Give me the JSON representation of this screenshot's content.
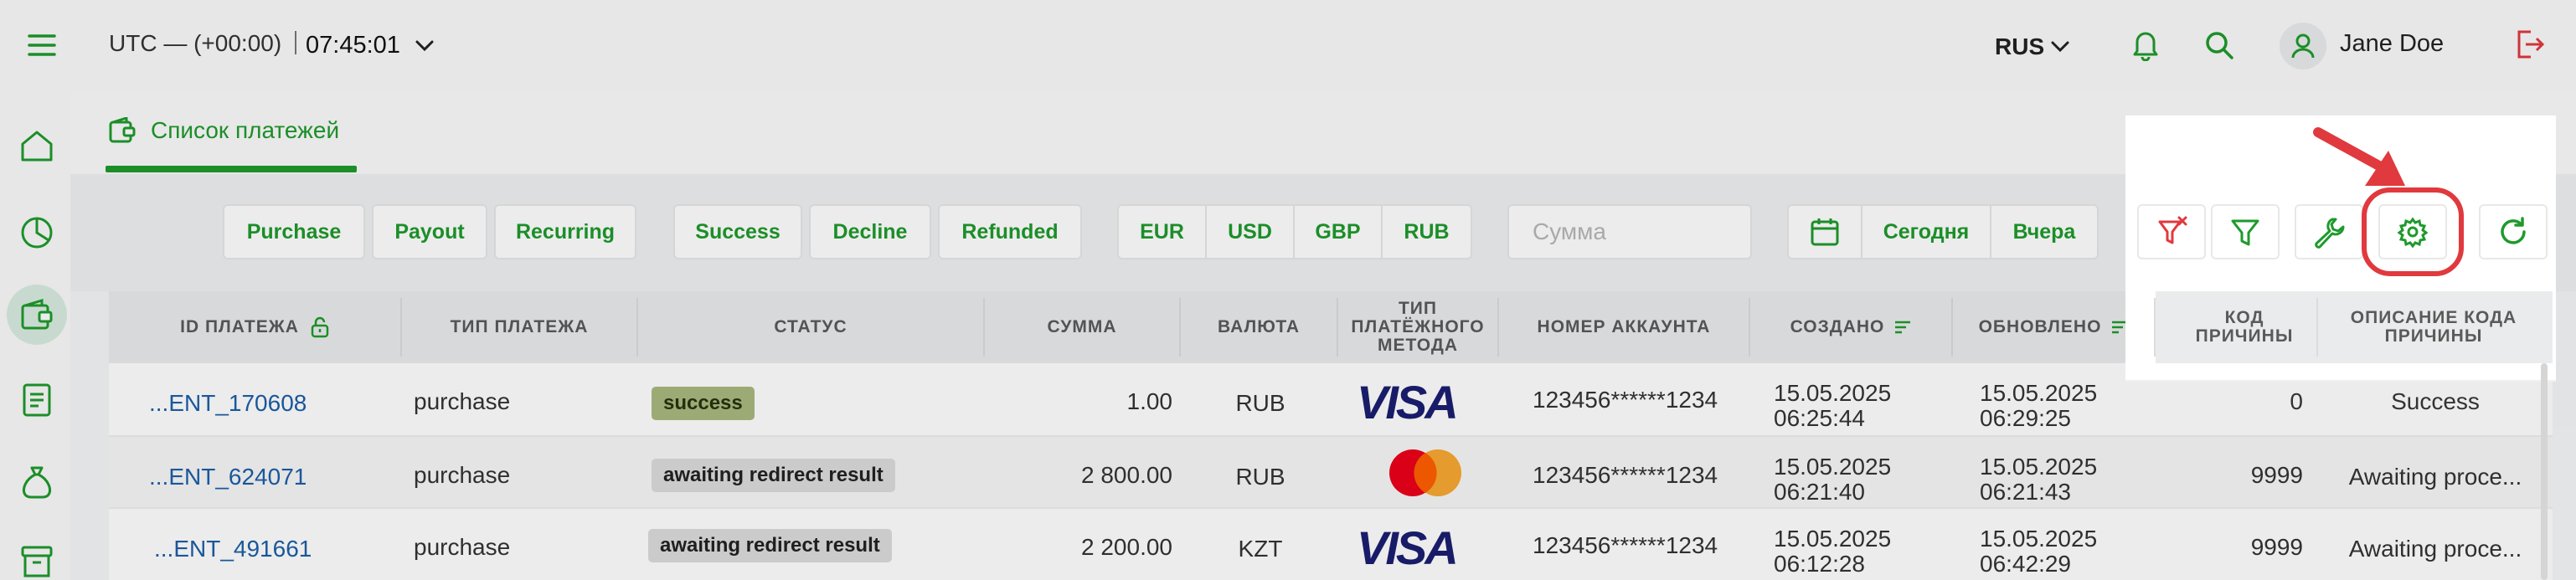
{
  "header": {
    "timezone_label": "UTC — (+00:00)",
    "time": "07:45:01",
    "language": "RUS",
    "user_name": "Jane Doe"
  },
  "tab": {
    "label": "Список платежей"
  },
  "filters": {
    "type_buttons": [
      "Purchase",
      "Payout",
      "Recurring"
    ],
    "status_buttons": [
      "Success",
      "Decline",
      "Refunded"
    ],
    "currency_buttons": [
      "EUR",
      "USD",
      "GBP",
      "RUB"
    ],
    "amount_placeholder": "Сумма",
    "date_buttons": [
      "Сегодня",
      "Вчера"
    ]
  },
  "table": {
    "headers": {
      "id": "ID ПЛАТЕЖА",
      "type": "ТИП ПЛАТЕЖА",
      "status": "СТАТУС",
      "amount": "СУММА",
      "currency": "ВАЛЮТА",
      "method": "ТИП ПЛАТЁЖНОГО МЕТОДА",
      "account": "НОМЕР АККАУНТА",
      "created": "СОЗДАНО",
      "updated": "ОБНОВЛЕНО",
      "reason_code": "КОД ПРИЧИНЫ",
      "reason_desc": "ОПИСАНИЕ КОДА ПРИЧИНЫ"
    },
    "rows": [
      {
        "id": "...ENT_170608",
        "type": "purchase",
        "status": "success",
        "amount": "1.00",
        "currency": "RUB",
        "method": "VISA",
        "account": "123456******1234",
        "created_date": "15.05.2025",
        "created_time": "06:25:44",
        "updated_date": "15.05.2025",
        "updated_time": "06:29:25",
        "reason_code": "0",
        "reason_desc": "Success"
      },
      {
        "id": "...ENT_624071",
        "type": "purchase",
        "status": "awaiting redirect result",
        "amount": "2 800.00",
        "currency": "RUB",
        "method": "mastercard",
        "account": "123456******1234",
        "created_date": "15.05.2025",
        "created_time": "06:21:40",
        "updated_date": "15.05.2025",
        "updated_time": "06:21:43",
        "reason_code": "9999",
        "reason_desc": "Awaiting proce..."
      },
      {
        "id": "...ENT_491661",
        "type": "purchase",
        "status": "awaiting redirect result",
        "amount": "2 200.00",
        "currency": "KZT",
        "method": "VISA",
        "account": "123456******1234",
        "created_date": "15.05.2025",
        "created_time": "06:12:28",
        "updated_date": "15.05.2025",
        "updated_time": "06:42:29",
        "reason_code": "9999",
        "reason_desc": "Awaiting proce..."
      }
    ]
  },
  "colors": {
    "accent": "#1e9a2c",
    "link": "#1d5fa8",
    "annotation": "#e0393e",
    "success_badge": "#a9b97f",
    "pending_badge": "#dcdcdc"
  },
  "icons": {
    "menu": "hamburger-icon",
    "sidebar": [
      "home-icon",
      "pie-chart-icon",
      "wallet-icon",
      "document-icon",
      "money-bag-icon",
      "archive-icon"
    ],
    "toolbar": [
      "filter-clear-icon",
      "filter-icon",
      "wrench-icon",
      "gear-icon",
      "refresh-icon"
    ]
  }
}
